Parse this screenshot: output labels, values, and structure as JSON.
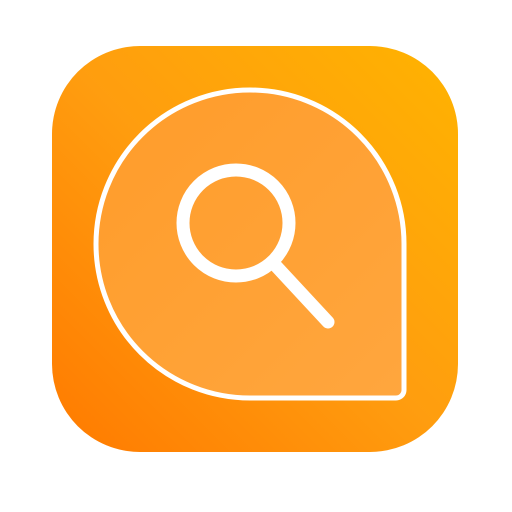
{
  "icon": {
    "name": "search-bubble-app-icon",
    "symbol": "magnifying-glass",
    "colors": {
      "background_light": "#ffb300",
      "background_mid": "#ff9d0f",
      "background_dark": "#ff7a00",
      "bubble_fill": "#ffa33a",
      "bubble_stroke": "#ffffff",
      "glyph": "#ffffff"
    }
  }
}
